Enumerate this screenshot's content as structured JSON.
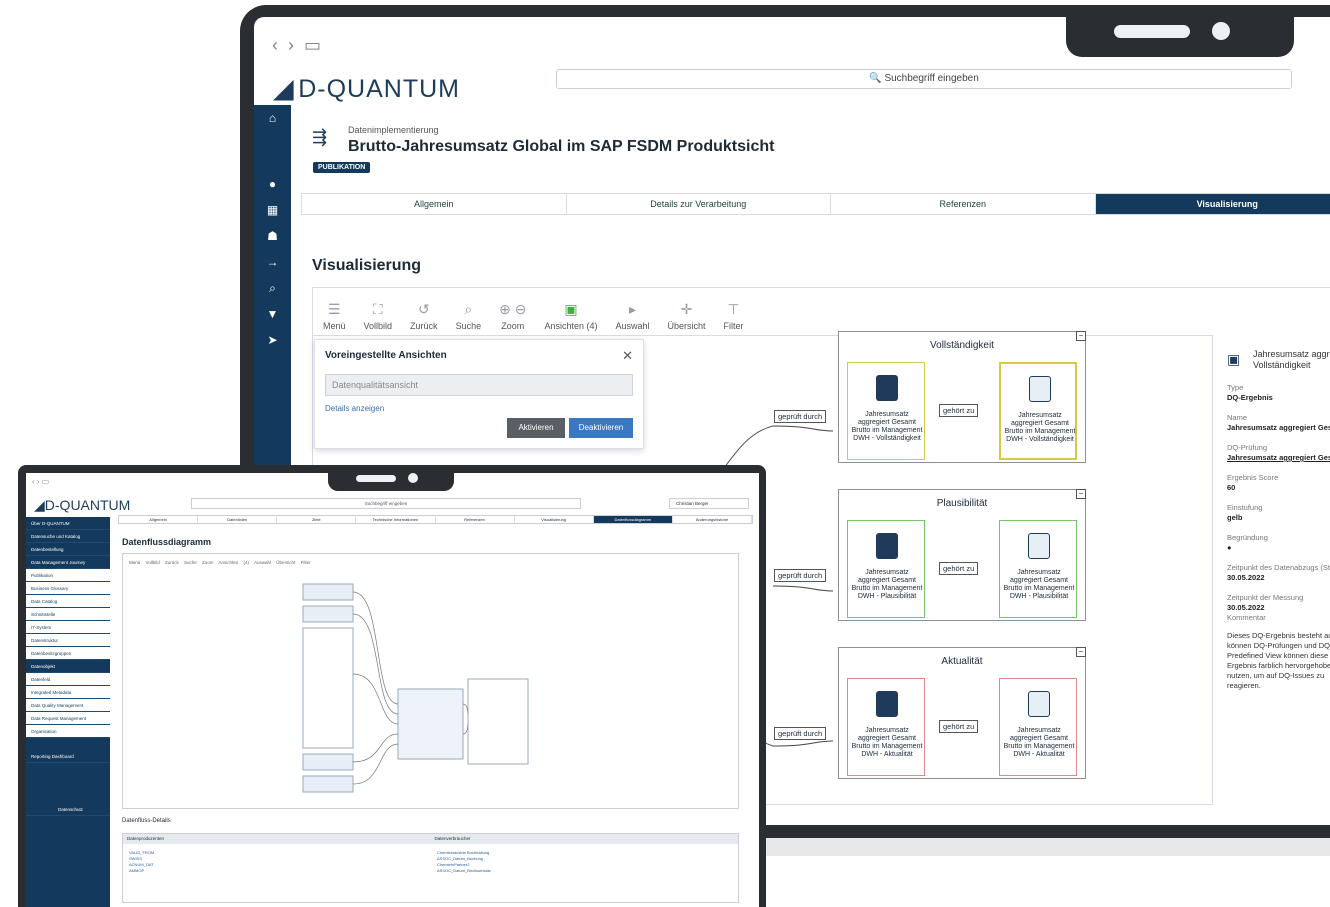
{
  "main": {
    "logo": "D-QUANTUM",
    "search_placeholder": "Suchbegriff eingeben",
    "breadcrumb": "Datenimplementierung",
    "title": "Brutto-Jahresumsatz Global im SAP FSDM Produktsicht",
    "badge": "PUBLIKATION",
    "tabs": [
      "Allgemein",
      "Details zur Verarbeitung",
      "Referenzen",
      "Visualisierung"
    ],
    "section": "Visualisierung",
    "toolbar": [
      "Menü",
      "Vollbild",
      "Zurück",
      "Suche",
      "Zoom",
      "Ansichten (4)",
      "Auswahl",
      "Übersicht",
      "Filter"
    ],
    "popup": {
      "title": "Voreingestellte Ansichten",
      "select": "Datenqualitätsansicht",
      "link": "Details anzeigen",
      "activate": "Aktivieren",
      "deactivate": "Deaktivieren"
    },
    "groups": [
      {
        "title": "Vollständigkeit",
        "left": "Jahresumsatz aggregiert Gesamt Brutto im Management DWH - Vollständigkeit",
        "right": "Jahresumsatz aggregiert Gesamt Brutto im Management DWH - Vollständigkeit"
      },
      {
        "title": "Plausibilität",
        "left": "Jahresumsatz aggregiert Gesamt Brutto im Management DWH - Plausibilität",
        "right": "Jahresumsatz aggregiert Gesamt Brutto im Management DWH - Plausibilität"
      },
      {
        "title": "Aktualität",
        "left": "Jahresumsatz aggregiert Gesamt Brutto im Management DWH - Aktualität",
        "right": "Jahresumsatz aggregiert Gesamt Brutto im Management DWH - Aktualität"
      }
    ],
    "edge_checked": "geprüft durch",
    "edge_belongs": "gehört zu",
    "panel": {
      "header": "Jahresumsatz aggregiert Vollständigkeit",
      "fields": [
        {
          "k": "Type",
          "v": "DQ-Ergebnis"
        },
        {
          "k": "Name",
          "v": "Jahresumsatz aggregiert Gesamt"
        },
        {
          "k": "DQ-Prüfung",
          "v": "Jahresumsatz aggregiert Gesamt"
        },
        {
          "k": "Ergebnis Score",
          "v": "60"
        },
        {
          "k": "Einstufung",
          "v": "gelb"
        },
        {
          "k": "Begründung",
          "v": "●"
        },
        {
          "k": "Zeitpunkt des Datenabzugs (Stichtag)",
          "v": "30.05.2022"
        },
        {
          "k": "Zeitpunkt der Messung",
          "v": "30.05.2022"
        },
        {
          "k": "Kommentar",
          "v": ""
        }
      ],
      "comment": "Dieses DQ-Ergebnis besteht aus … können DQ-Prüfungen und DQ-Predefined View können diese nach Ergebnis farblich hervorgehoben nutzen, um auf DQ-Issues zu reagieren."
    }
  },
  "tablet": {
    "logo": "D-QUANTUM",
    "search": "Suchbegriff eingeben",
    "user": "Christian Berger",
    "tabs": [
      "Allgemein",
      "Datenlinien",
      "Ziele",
      "Technische Informationen",
      "Referenzen",
      "Visualisierung",
      "Datenflussdiagramm",
      "Änderungshistorie"
    ],
    "heading": "Datenflussdiagramm",
    "toolbar": "Menü Vollbild Zurück Suche Zoom Ansichten (4) Auswahl Übersicht Filter",
    "sidebar": [
      "Über D-QUANTUM",
      "Datensuche und Katalog",
      "Datenbestellung",
      "Data Management Journey",
      "Publikation",
      "Business Glossary",
      "Data Catalog",
      "Schnittstelle",
      "IT-System",
      "Datenstruktur",
      "Datenbesitzgruppen",
      "Datenobjekt",
      "Datenfeld",
      "Integrated Metadata",
      "Data Quality Management",
      "Data Request Management",
      "Organisation",
      "Reporting Dashboard",
      "Datenschutz"
    ],
    "details_title": "Datenfluss-Details",
    "col1": "Datenproduzenten",
    "col2": "Datenverbraucher",
    "col1_items": [
      "VALID_FROM",
      "SWISS",
      "ACNUM_DAT",
      "AMMOP"
    ],
    "col2_items": [
      "Chemieindustrie Buchhaltung",
      "ASSOC_Datum_Buchung",
      "ChemieInPartner2",
      "ASSOC_Datum_Bruttoumsatz"
    ]
  }
}
